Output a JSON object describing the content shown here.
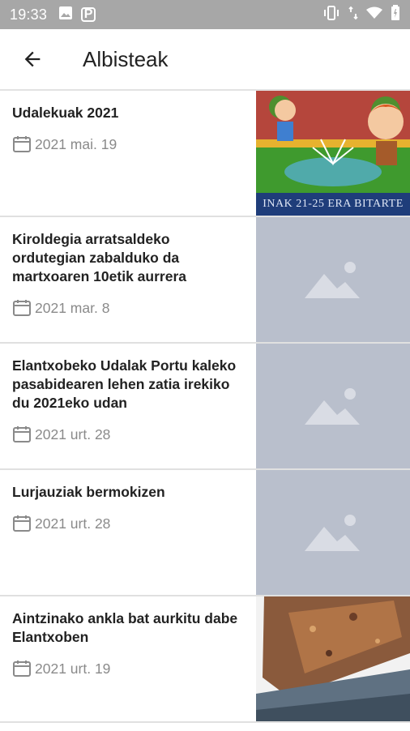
{
  "status": {
    "time": "19:33",
    "icons": [
      "image-icon",
      "p-app-icon",
      "vibrate-icon",
      "data-arrows-icon",
      "wifi-icon",
      "battery-icon"
    ]
  },
  "appbar": {
    "title": "Albisteak",
    "back_icon": "arrow-back-icon"
  },
  "news": [
    {
      "title": "Udalekuak 2021",
      "date": "2021 mai. 19",
      "thumb": "illustration",
      "banner_text": "INAK 21-25 ERA BITARTE"
    },
    {
      "title": "Kiroldegia arratsaldeko ordutegian zabalduko da martxoaren 10etik aurrera",
      "date": "2021 mar. 8",
      "thumb": "placeholder"
    },
    {
      "title": "Elantxobeko Udalak Portu kaleko pasabidearen lehen zatia irekiko du 2021eko udan",
      "date": "2021 urt. 28",
      "thumb": "placeholder"
    },
    {
      "title": "Lurjauziak bermokizen",
      "date": "2021 urt. 28",
      "thumb": "placeholder"
    },
    {
      "title": "Aintzinako ankla bat aurkitu dabe Elantxoben",
      "date": "2021 urt. 19",
      "thumb": "photo"
    }
  ],
  "colors": {
    "statusbar": "#a7a7a7",
    "placeholder": "#b9bfcc",
    "divider": "#e0e0e0",
    "date": "#8a8a8a"
  }
}
